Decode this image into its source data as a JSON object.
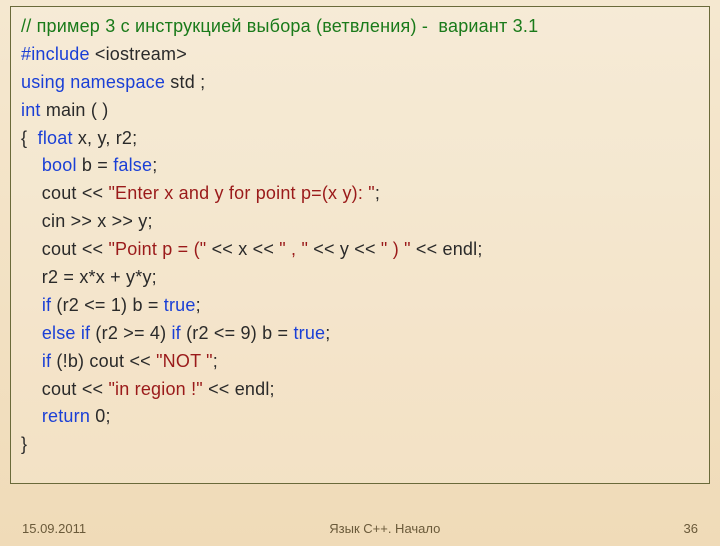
{
  "code": {
    "l1a": "// пример 3 с инструкцией выбора (ветвления) -  вариант 3.1",
    "l2a": "#include",
    "l2b": " <iostream>",
    "l3a": "using namespace",
    "l3b": " std ;",
    "l4a": "int",
    "l4b": " main ( )",
    "l5a": "{  ",
    "l5b": "float",
    "l5c": " x, y, r2;",
    "l6a": "    ",
    "l6b": "bool",
    "l6c": " b = ",
    "l6d": "false",
    "l6e": ";",
    "l7a": "    cout << ",
    "l7b": "\"Enter x and y for point p=(x y): \"",
    "l7c": ";",
    "l8a": "    cin >> x >> y;",
    "l9a": "    cout << ",
    "l9b": "\"Point p = (\"",
    "l9c": " << x << ",
    "l9d": "\" , \"",
    "l9e": " << y << ",
    "l9f": "\" ) \"",
    "l9g": " << endl;",
    "l10a": "    r2 = x*x + y*y;",
    "l11a": "    ",
    "l11b": "if",
    "l11c": " (r2 <= 1) b = ",
    "l11d": "true",
    "l11e": ";",
    "l12a": "    ",
    "l12b": "else if",
    "l12c": " (r2 >= 4) ",
    "l12d": "if",
    "l12e": " (r2 <= 9) b = ",
    "l12f": "true",
    "l12g": ";",
    "l13a": "    ",
    "l13b": "if",
    "l13c": " (!b) cout << ",
    "l13d": "\"NOT \"",
    "l13e": ";",
    "l14a": "    cout << ",
    "l14b": "\"in region !\"",
    "l14c": " << endl;",
    "l15a": "    ",
    "l15b": "return",
    "l15c": " 0;",
    "l16a": "}"
  },
  "footer": {
    "date": "15.09.2011",
    "title": "Язык С++. Начало",
    "page": "36"
  }
}
